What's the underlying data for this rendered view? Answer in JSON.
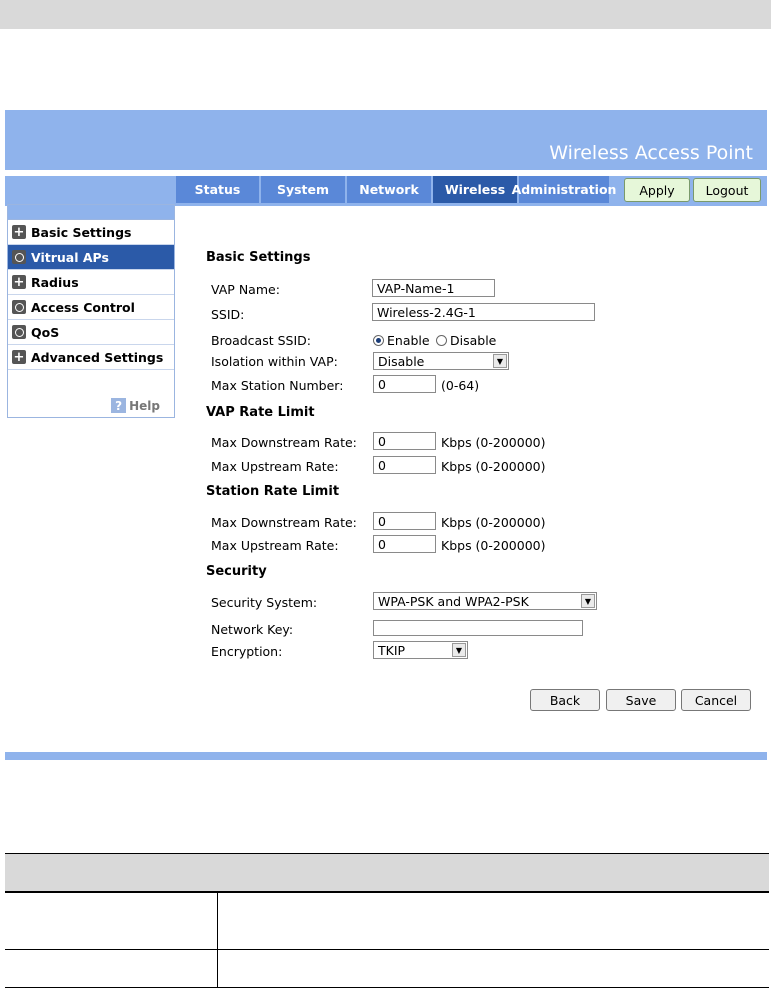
{
  "app": {
    "title": "Wireless Access Point"
  },
  "nav": {
    "tabs": [
      {
        "label": "Status"
      },
      {
        "label": "System"
      },
      {
        "label": "Network"
      },
      {
        "label": "Wireless"
      },
      {
        "label": "Administration"
      }
    ],
    "active_tab": "Wireless",
    "apply_label": "Apply",
    "logout_label": "Logout"
  },
  "sidebar": {
    "items": [
      {
        "label": "Basic Settings",
        "icon": "plus-icon"
      },
      {
        "label": "Vitrual APs",
        "icon": "circle-icon"
      },
      {
        "label": "Radius",
        "icon": "plus-icon"
      },
      {
        "label": "Access Control",
        "icon": "circle-icon"
      },
      {
        "label": "QoS",
        "icon": "circle-icon"
      },
      {
        "label": "Advanced Settings",
        "icon": "plus-icon"
      }
    ],
    "active_item": "Vitrual APs",
    "help_label": "Help"
  },
  "form": {
    "basic": {
      "heading": "Basic Settings",
      "vap_name_label": "VAP Name:",
      "vap_name_value": "VAP-Name-1",
      "ssid_label": "SSID:",
      "ssid_value": "Wireless-2.4G-1",
      "broadcast_label": "Broadcast SSID:",
      "broadcast_enable": "Enable",
      "broadcast_disable": "Disable",
      "broadcast_selected": "Enable",
      "isolation_label": "Isolation within VAP:",
      "isolation_value": "Disable",
      "max_station_label": "Max Station Number:",
      "max_station_value": "0",
      "max_station_hint": "(0-64)"
    },
    "vap_rate": {
      "heading": "VAP Rate Limit",
      "down_label": "Max Downstream Rate:",
      "down_value": "0",
      "up_label": "Max Upstream Rate:",
      "up_value": "0",
      "hint": "Kbps (0-200000)"
    },
    "station_rate": {
      "heading": "Station Rate Limit",
      "down_label": "Max Downstream Rate:",
      "down_value": "0",
      "up_label": "Max Upstream Rate:",
      "up_value": "0",
      "hint": "Kbps (0-200000)"
    },
    "security": {
      "heading": "Security",
      "system_label": "Security System:",
      "system_value": "WPA-PSK and WPA2-PSK",
      "key_label": "Network Key:",
      "key_value": "",
      "encryption_label": "Encryption:",
      "encryption_value": "TKIP"
    },
    "buttons": {
      "back": "Back",
      "save": "Save",
      "cancel": "Cancel"
    }
  },
  "colors": {
    "banner": "#8fb3ec",
    "tab": "#5a88d8",
    "tab_active": "#2b5aa8",
    "button_green": "#e6f7d9"
  }
}
